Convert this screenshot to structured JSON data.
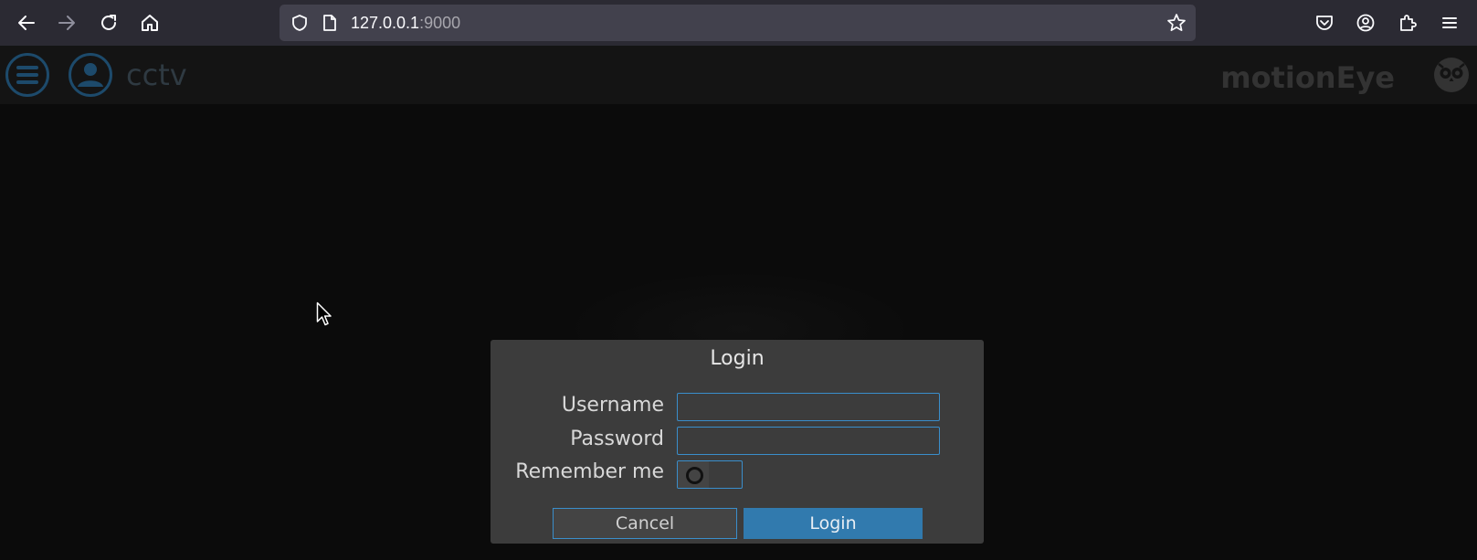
{
  "browser": {
    "url_host": "127.0.0.1",
    "url_port": ":9000",
    "icons": {
      "back": "arrow-left-icon",
      "forward": "arrow-right-icon",
      "reload": "reload-icon",
      "home": "home-icon",
      "shield": "shield-icon",
      "page": "page-icon",
      "bookmark": "star-icon",
      "pocket": "pocket-icon",
      "account": "account-icon",
      "extensions": "puzzle-icon",
      "menu": "hamburger-menu-icon"
    }
  },
  "app": {
    "title": "cctv",
    "brand": "motionEye",
    "icons": {
      "menu": "hamburger-menu-icon",
      "user": "user-icon",
      "logo": "owl-logo-icon"
    }
  },
  "dialog": {
    "title": "Login",
    "username_label": "Username",
    "username_value": "",
    "password_label": "Password",
    "password_value": "",
    "remember_label": "Remember me",
    "remember_checked": false,
    "cancel_label": "Cancel",
    "login_label": "Login"
  },
  "colors": {
    "accent": "#3a8ecb",
    "login_button": "#317aae",
    "dialog_bg": "#3c3c3c",
    "page_bg": "#0b0b0b",
    "header_bg": "#141414"
  }
}
